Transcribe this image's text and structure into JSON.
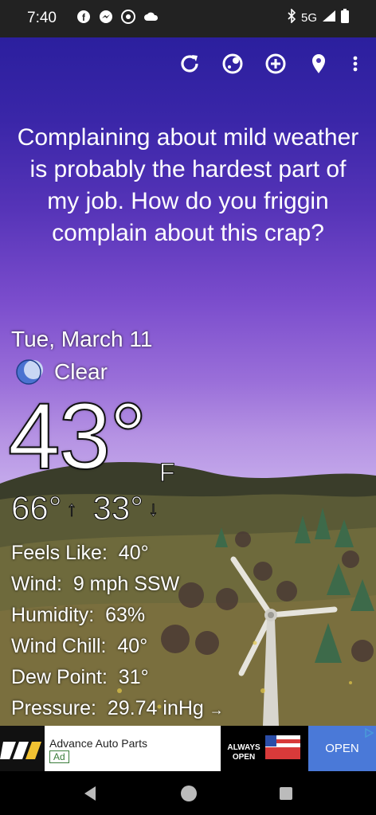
{
  "status_bar": {
    "time": "7:40",
    "network": "5G"
  },
  "toolbar": {
    "icons": [
      "refresh-icon",
      "theme-icon",
      "add-icon",
      "location-icon",
      "more-icon"
    ]
  },
  "quote": "Complaining about mild weather is probably the hardest part of my job. How do you friggin complain about this crap?",
  "weather": {
    "date": "Tue, March 11",
    "condition": "Clear",
    "temperature": "43°",
    "unit": "F",
    "high": "66°",
    "low": "33°",
    "high_arrow": "↑",
    "low_arrow": "↓",
    "details": [
      {
        "label": "Feels Like:",
        "value": "40°"
      },
      {
        "label": "Wind:",
        "value": "9 mph SSW"
      },
      {
        "label": "Humidity:",
        "value": "63%"
      },
      {
        "label": "Wind Chill:",
        "value": "40°"
      },
      {
        "label": "Dew Point:",
        "value": "31°"
      },
      {
        "label": "Pressure:",
        "value": "29.74 inHg",
        "trend": "→"
      }
    ]
  },
  "ad": {
    "title": "Advance Auto Parts",
    "badge": "Ad",
    "image_text": "ALWAYS OPEN",
    "cta": "OPEN"
  },
  "colors": {
    "sky_top": "#2b1f9e",
    "sky_bottom": "#c2a6ea",
    "status_bar": "#222222",
    "ad_cta": "#4a79d8"
  }
}
